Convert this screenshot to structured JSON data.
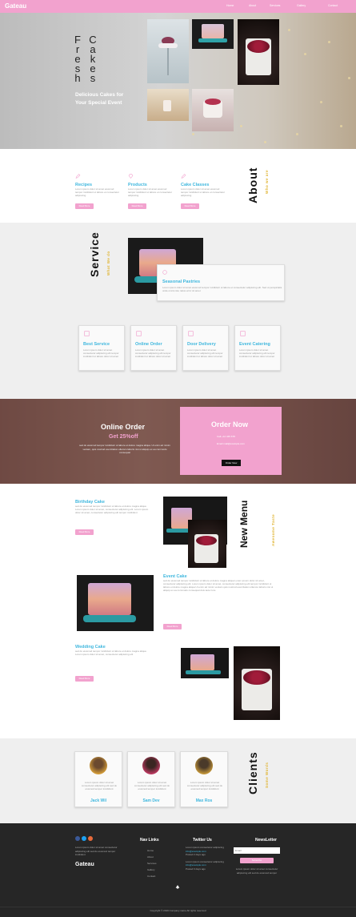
{
  "nav": {
    "logo": "Gateau",
    "links": [
      "Home",
      "About",
      "Services",
      "Gallery",
      "Contact"
    ]
  },
  "hero": {
    "word1": [
      "F",
      "r",
      "e",
      "s",
      "h"
    ],
    "word2": [
      "C",
      "a",
      "k",
      "e",
      "s"
    ],
    "subtitle_line1": "Delicious Cakes for",
    "subtitle_line2": "Your Special Event"
  },
  "about": {
    "heading": "About",
    "subheading": "Who we are",
    "features": [
      {
        "icon": "pencil-icon",
        "title": "Recipes",
        "text": "Lorem ipsum dolor sit amet eiusmod tempor incididunt ut labore et consectetur adipiscing",
        "button": "Read More"
      },
      {
        "icon": "diamond-icon",
        "title": "Products",
        "text": "Lorem ipsum dolor sit amet eiusmod tempor incididunt ut labore et consectetur adipiscing",
        "button": "Read More"
      },
      {
        "icon": "pencil-icon",
        "title": "Cake Classes",
        "text": "Lorem ipsum dolor sit amet eiusmod tempor incididunt ut labore et consectetur adipiscing",
        "button": "Read More"
      }
    ]
  },
  "service": {
    "heading": "Service",
    "subheading": "What We do",
    "featured": {
      "title": "Seasonal Pastries",
      "text": "Lorem ipsum dolor sit amet eiusmod tempor incididunt ut labore et consectetur adipiscing elit. Sed ut perspiciatis unde omnis iste natus error sit amet"
    },
    "items": [
      {
        "title": "Best Service",
        "text": "Lorem ipsum dolor sit amet consectetur adipiscing elit tempor incididunt ut labore dolor sit amet"
      },
      {
        "title": "Online Order",
        "text": "Lorem ipsum dolor sit amet consectetur adipiscing elit tempor incididunt ut labore dolor sit amet"
      },
      {
        "title": "Door Delivery",
        "text": "Lorem ipsum dolor sit amet consectetur adipiscing elit tempor incididunt ut labore dolor sit amet"
      },
      {
        "title": "Event Catering",
        "text": "Lorem ipsum dolor sit amet consectetur adipiscing elit tempor incididunt ut labore dolor sit amet"
      }
    ]
  },
  "order": {
    "title": "Online Order",
    "discount": "Get 25%off",
    "text": "sed do eiusmod tempor incididunt ut labore et dolore magna aliqua. Ut enim ad minim veniam, quis nostrud exercitation ullamco laboris nisi ut aliquip ex ea commodo consequat",
    "box_title": "Order Now",
    "call_label": "Call",
    "call_value": "+12 345 678",
    "email_label": "Email",
    "email_value": "mail@example.com",
    "button": "Order Now"
  },
  "menu": {
    "heading_line1": "New",
    "heading_line2": "Menu",
    "subheading": "Awesome Taste",
    "items": [
      {
        "title": "Birthday Cake",
        "text": "sed do eiusmod tempor incididunt ut labore et dolore magna aliqua Lorem ipsum dolor sit amet, consectetur adipiscing elit. Lorem ipsum dolor sit amet, consectetur adipiscing elit tempor incididunt",
        "button": "Read More"
      },
      {
        "title": "Event Cake",
        "text": "sed do eiusmod tempor incididunt ut labore et dolore magna aliqua Lorem ipsum dolor sit amet, consectetur adipiscing elit. Lorem ipsum dolor sit amet, consectetur adipiscing elit tempor incididunt ut labore et dolore magna aliqua Ut enim ad minim veniam quis nostrud exercitation ullamco laboris nisi ut aliquip ex ea commodo consequat duis aute irure",
        "button": "Read More"
      },
      {
        "title": "Wedding Cake",
        "text": "sed do eiusmod tempor incididunt ut labore et dolore magna aliqua Lorem ipsum dolor sit amet, consectetur adipiscing elit",
        "button": "Read More"
      }
    ]
  },
  "clients": {
    "heading": "Clients",
    "subheading": "Some Words",
    "items": [
      {
        "name": "Jack Wil",
        "text": "Lorem ipsum dolor sit amet consectetur adipiscing elit sed do eiusmod tempor incididunt"
      },
      {
        "name": "Sam Dev",
        "text": "Lorem ipsum dolor sit amet consectetur adipiscing elit sed do eiusmod tempor incididunt"
      },
      {
        "name": "Max Ros",
        "text": "Lorem ipsum dolor sit amet consectetur adipiscing elit sed do eiusmod tempor incididunt"
      }
    ]
  },
  "footer": {
    "logo": "Gateau",
    "about_text": "Lorem ipsum dolor sit amet consectetur adipiscing elit sed do eiusmod tempor incididunt",
    "social": [
      "facebook-icon",
      "twitter-icon",
      "google-icon"
    ],
    "nav_heading": "Nav Links",
    "nav_links": [
      "Home",
      "About",
      "Services",
      "Gallery",
      "Contact"
    ],
    "twitter_heading": "Twitter Us",
    "tweets": [
      "Lorem ipsum consectetur adipiscing",
      "info@example.com",
      "Posted 2 days ago",
      "Lorem ipsum consectetur adipiscing",
      "info@example.com",
      "Posted 3 days ago"
    ],
    "newsletter_heading": "NewsLetter",
    "email_placeholder": "Email",
    "subscribe": "Subscribe",
    "newsletter_text": "Lorem ipsum dolor sit amet consectetur adipiscing elit sed do eiusmod tempor",
    "copyright": "Copyright © 2019 Company name All rights reserved"
  },
  "colors": {
    "pink": "#f2a2ce",
    "blue": "#3fb7de",
    "gold": "#e0b534",
    "dark": "#262626"
  }
}
